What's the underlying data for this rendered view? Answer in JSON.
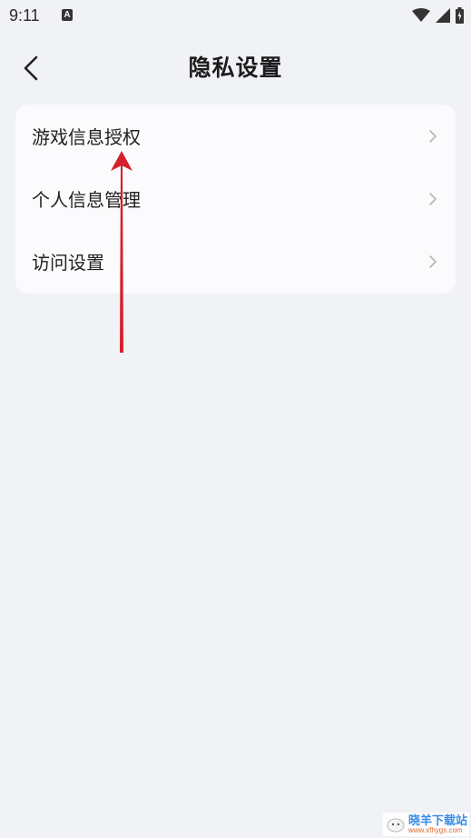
{
  "status_bar": {
    "time": "9:11",
    "notification_icon_letter": "A",
    "icons": [
      "wifi-icon",
      "signal-icon",
      "battery-icon"
    ]
  },
  "header": {
    "back_icon": "chevron-left-icon",
    "title": "隐私设置"
  },
  "settings": {
    "items": [
      {
        "label": "游戏信息授权",
        "icon": "chevron-right-icon"
      },
      {
        "label": "个人信息管理",
        "icon": "chevron-right-icon"
      },
      {
        "label": "访问设置",
        "icon": "chevron-right-icon"
      }
    ]
  },
  "annotation": {
    "arrow_color": "#d6202a"
  },
  "watermark": {
    "title": "晓羊下载站",
    "url": "www.xfhygs.com"
  },
  "colors": {
    "background": "#f1f2f6",
    "card": "#fbfbfd",
    "text": "#222222",
    "chevron": "#b5b5b5"
  }
}
